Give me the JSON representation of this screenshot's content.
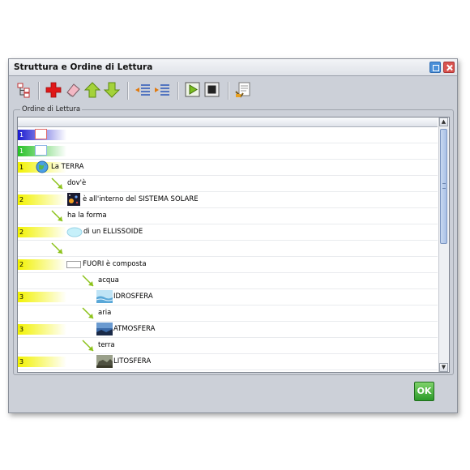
{
  "window": {
    "title": "Struttura e Ordine di Lettura"
  },
  "toolbar": {
    "icons": [
      "tree-structure-icon",
      "add-icon",
      "eraser-icon",
      "move-up-icon",
      "move-down-icon",
      "outdent-icon",
      "indent-icon",
      "play-icon",
      "stop-icon",
      "properties-icon"
    ]
  },
  "panel": {
    "legend": "Ordine di Lettura"
  },
  "rows": [
    {
      "level": "1",
      "text": ""
    },
    {
      "level": "1",
      "text": ""
    },
    {
      "level": "1",
      "text": "La TERRA"
    },
    {
      "level": "",
      "text": "dov'è"
    },
    {
      "level": "2",
      "text": "è all'interno del SISTEMA SOLARE"
    },
    {
      "level": "",
      "text": "ha la forma"
    },
    {
      "level": "2",
      "text": "di un ELLISSOIDE"
    },
    {
      "level": "",
      "text": ""
    },
    {
      "level": "2",
      "text": "FUORI è composta"
    },
    {
      "level": "",
      "text": "acqua"
    },
    {
      "level": "3",
      "text": "IDROSFERA"
    },
    {
      "level": "",
      "text": "aria"
    },
    {
      "level": "3",
      "text": "ATMOSFERA"
    },
    {
      "level": "",
      "text": "terra"
    },
    {
      "level": "3",
      "text": "LITOSFERA"
    }
  ],
  "footer": {
    "ok_label": "OK"
  },
  "colors": {
    "level_yellow": "#f2f200",
    "level_blue": "#1a1ad0",
    "level_green": "#24c024",
    "arrow_green": "#8cc21a"
  }
}
